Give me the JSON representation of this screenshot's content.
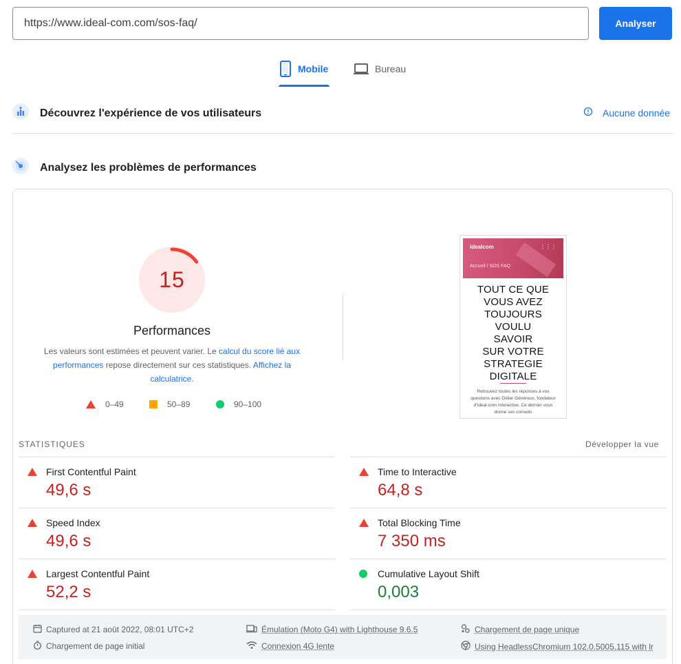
{
  "search": {
    "url_value": "https://www.ideal-com.com/sos-faq/",
    "analyze_label": "Analyser"
  },
  "tabs": [
    {
      "label": "Mobile",
      "icon": "smartphone-icon",
      "active": true
    },
    {
      "label": "Bureau",
      "icon": "laptop-icon",
      "active": false
    }
  ],
  "field_data": {
    "title": "Découvrez l'expérience de vos utilisateurs",
    "status": "Aucune donnée",
    "icon": "users-chart-icon"
  },
  "lab_data": {
    "title": "Analysez les problèmes de performances",
    "icon": "radar-icon"
  },
  "score": {
    "value": "15",
    "label": "Performances",
    "fraction": 0.15,
    "color": "#c5221f"
  },
  "description": {
    "part1": "Les valeurs sont estimées et peuvent varier. Le ",
    "link1": "calcul du score lié aux performances",
    "part2": " repose directement sur ces statistiques. ",
    "link2": "Affichez la calculatrice."
  },
  "legend": [
    {
      "range": "0–49",
      "icon": "fail-triangle-icon",
      "color": "#eb4335"
    },
    {
      "range": "50–89",
      "icon": "average-square-icon",
      "color": "#ffa400"
    },
    {
      "range": "90–100",
      "icon": "pass-circle-icon",
      "color": "#0cce6b"
    }
  ],
  "thumbnail": {
    "logo": "idealcom",
    "breadcrumb": "Accueil / SOS FAQ",
    "heading": [
      "TOUT CE QUE",
      "VOUS AVEZ",
      "TOUJOURS",
      "VOULU",
      "SAVOIR",
      "SUR VOTRE",
      "STRATEGIE",
      "DIGITALE"
    ],
    "body": "Retrouvez toutes les réponses à vos questions avec Didier Génèreux, fondateur d'Ideal-com Interactive. Ce dernier vous donne ses conseils"
  },
  "stats": {
    "label": "STATISTIQUES",
    "expand_label": "Développer la vue",
    "metrics": [
      {
        "name": "First Contentful Paint",
        "value": "49,6 s",
        "status": "fail"
      },
      {
        "name": "Time to Interactive",
        "value": "64,8 s",
        "status": "fail"
      },
      {
        "name": "Speed Index",
        "value": "49,6 s",
        "status": "fail"
      },
      {
        "name": "Total Blocking Time",
        "value": "7 350 ms",
        "status": "fail"
      },
      {
        "name": "Largest Contentful Paint",
        "value": "52,2 s",
        "status": "fail"
      },
      {
        "name": "Cumulative Layout Shift",
        "value": "0,003",
        "status": "pass"
      }
    ]
  },
  "meta": [
    {
      "text": "Captured at 21 août 2022, 08:01 UTC+2",
      "icon": "calendar-icon"
    },
    {
      "text": "Chargement de page initial",
      "icon": "stopwatch-icon"
    },
    {
      "text": "Émulation (Moto G4) with Lighthouse 9.6.5",
      "icon": "devices-icon"
    },
    {
      "text": "Connexion 4G lente",
      "icon": "network-icon"
    },
    {
      "text": "Chargement de page unique",
      "icon": "single-page-icon"
    },
    {
      "text": "Using HeadlessChromium 102.0.5005.115 with lr",
      "icon": "chrome-icon"
    }
  ]
}
